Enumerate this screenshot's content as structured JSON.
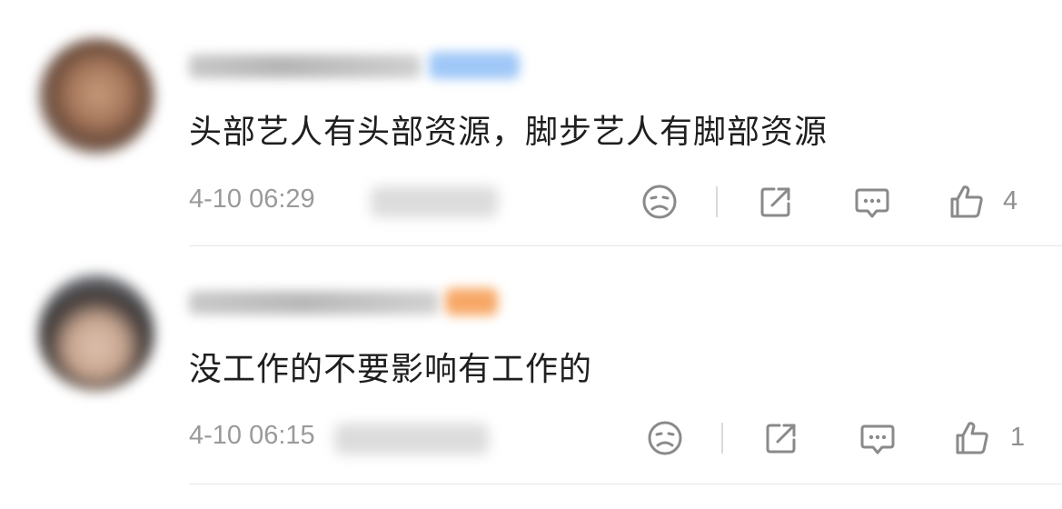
{
  "comments": [
    {
      "content": "头部艺人有头部资源，脚步艺人有脚部资源",
      "time": "4-10 06:29",
      "like_count": "4",
      "badge_color": "#9fc7f7"
    },
    {
      "content": "没工作的不要影响有工作的",
      "time": "4-10 06:15",
      "like_count": "1",
      "badge_color": "#f7a866"
    }
  ],
  "icons": {
    "dislike": "sad-face-icon",
    "share": "share-icon",
    "comment": "comment-bubble-icon",
    "like": "thumbs-up-icon"
  },
  "colors": {
    "icon": "#8a8a8a",
    "meta_text": "#9a9a9a",
    "divider": "#e7e7e7"
  }
}
